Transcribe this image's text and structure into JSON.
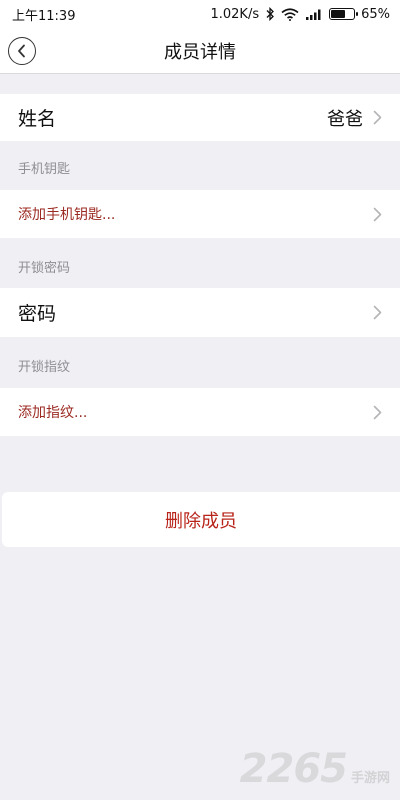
{
  "status_bar": {
    "time": "上午11:39",
    "network_speed": "1.02K/s",
    "battery": "65%",
    "battery_level": 0.65,
    "icons": [
      "bluetooth-icon",
      "wifi-icon",
      "signal-icon",
      "battery-icon"
    ]
  },
  "header": {
    "title": "成员详情",
    "back_icon": "chevron-left-icon"
  },
  "name_row": {
    "label": "姓名",
    "value": "爸爸"
  },
  "phone_key_section": {
    "title": "手机钥匙",
    "add_label": "添加手机钥匙..."
  },
  "password_section": {
    "title": "开锁密码",
    "row_label": "密码"
  },
  "fingerprint_section": {
    "title": "开锁指纹",
    "add_label": "添加指纹..."
  },
  "delete_button": {
    "label": "删除成员"
  },
  "watermark": {
    "digits": "2265",
    "suffix": "手游网"
  },
  "colors": {
    "background": "#efeff4",
    "link_text": "#9b2a22",
    "delete_text": "#b8241a",
    "section_label": "#8e8e93"
  }
}
